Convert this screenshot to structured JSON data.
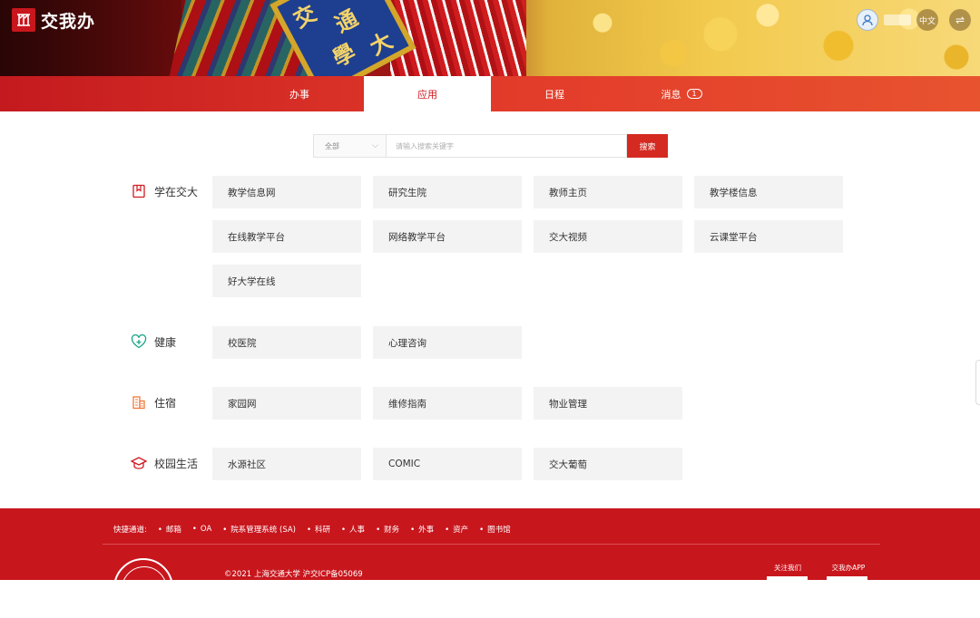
{
  "brand": {
    "name": "交我办"
  },
  "header": {
    "lang_label": "中文",
    "switch_icon": "⇌"
  },
  "hero_plaque": {
    "chars": [
      "交",
      "通",
      "大",
      "學"
    ]
  },
  "nav": {
    "tabs": [
      {
        "label": "办事",
        "active": false
      },
      {
        "label": "应用",
        "active": true
      },
      {
        "label": "日程",
        "active": false
      },
      {
        "label": "消息",
        "active": false,
        "badge": "1"
      }
    ]
  },
  "search": {
    "scope": "全部",
    "placeholder": "请输入搜索关键字",
    "button": "搜索"
  },
  "categories": [
    {
      "name": "学在交大",
      "icon": "book-icon",
      "items": [
        "教学信息网",
        "研究生院",
        "教师主页",
        "教学楼信息",
        "在线教学平台",
        "网络教学平台",
        "交大视频",
        "云课堂平台",
        "好大学在线"
      ]
    },
    {
      "name": "健康",
      "icon": "heart-plus-icon",
      "items": [
        "校医院",
        "心理咨询"
      ]
    },
    {
      "name": "住宿",
      "icon": "building-icon",
      "items": [
        "家园网",
        "维修指南",
        "物业管理"
      ]
    },
    {
      "name": "校园生活",
      "icon": "graduation-cap-icon",
      "items": [
        "水源社区",
        "COMIC",
        "交大葡萄"
      ]
    }
  ],
  "footer": {
    "quick_label": "快捷通道:",
    "quick_links": [
      "邮箱",
      "OA",
      "院系管理系统 (SA)",
      "科研",
      "人事",
      "财务",
      "外事",
      "资产",
      "图书馆"
    ],
    "copyright": "©2021 上海交通大学 沪交ICP备05069",
    "follow_label": "关注我们",
    "app_label": "交我办APP"
  },
  "colors": {
    "primary": "#d0191f",
    "tile_bg": "#f3f3f3",
    "footer_bg": "#c8161d"
  }
}
